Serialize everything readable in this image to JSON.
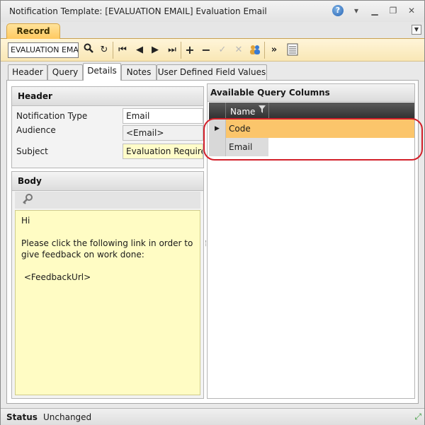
{
  "window": {
    "title": "Notification Template: [EVALUATION EMAIL] Evaluation Email"
  },
  "titlebar_icons": [
    "help-icon",
    "dropdown-icon",
    "minimize-icon",
    "restore-icon",
    "close-icon"
  ],
  "ribbon": {
    "tab": "Record"
  },
  "toolbar": {
    "record_value": "EVALUATION EMAIL",
    "icons": [
      "search-icon",
      "refresh-icon",
      "first-record-icon",
      "previous-record-icon",
      "next-record-icon",
      "last-record-icon",
      "add-icon",
      "remove-icon",
      "save-check-icon",
      "cancel-x-icon",
      "users-icon",
      "more-icon",
      "list-icon"
    ]
  },
  "tabs": [
    {
      "label": "Header",
      "active": false
    },
    {
      "label": "Query",
      "active": false
    },
    {
      "label": "Details",
      "active": true
    },
    {
      "label": "Notes",
      "active": false
    },
    {
      "label": "User Defined Field Values",
      "active": false
    }
  ],
  "header_panel": {
    "title": "Header",
    "fields": [
      {
        "label": "Notification Type",
        "value": "Email"
      },
      {
        "label": "Audience",
        "value": "<Email>"
      },
      {
        "label": "Subject",
        "value": "Evaluation Required"
      }
    ]
  },
  "body_panel": {
    "title": "Body",
    "text": "Hi\n\nPlease click the following link in order to give feedback on work done:\n\n <FeedbackUrl>"
  },
  "query_columns": {
    "title": "Available Query Columns",
    "column_header": "Name",
    "rows": [
      {
        "name": "Code",
        "selected": true
      },
      {
        "name": "Email",
        "selected": false
      }
    ]
  },
  "status": {
    "label": "Status",
    "value": "Unchanged"
  },
  "colors": {
    "accent": "#ffc960",
    "selected_row": "#fbc56b",
    "annotation": "#d3202a",
    "body_bg": "#fffcc4"
  }
}
